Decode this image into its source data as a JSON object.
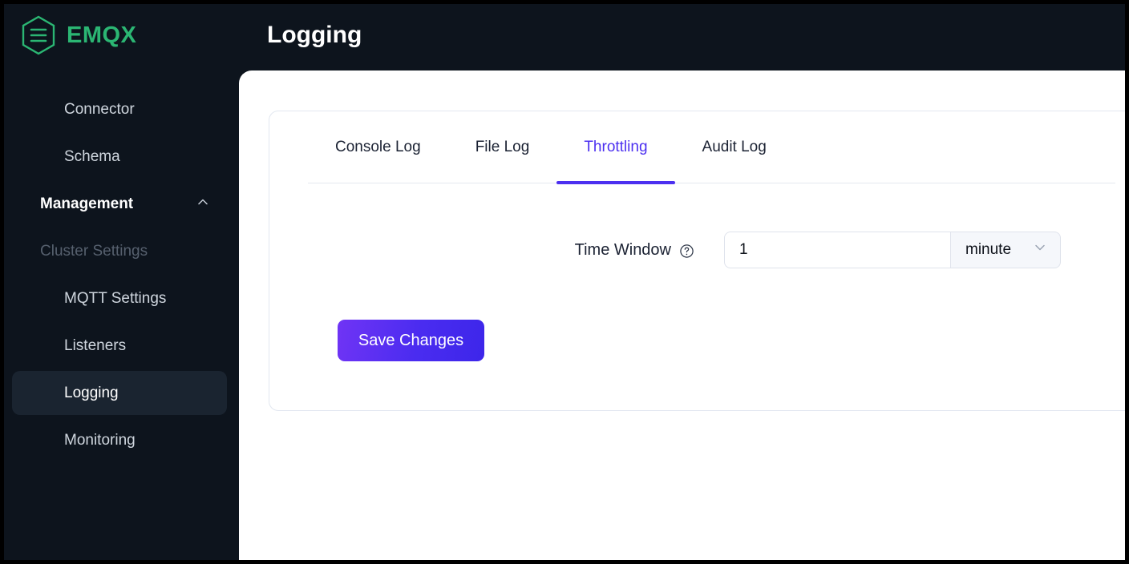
{
  "brand": {
    "name": "EMQX",
    "logo_icon": "emqx-hexagon-logo",
    "color": "#2bb673"
  },
  "sidebar": {
    "items": [
      {
        "label": "Connector",
        "type": "link",
        "active": false
      },
      {
        "label": "Schema",
        "type": "link",
        "active": false
      },
      {
        "label": "Management",
        "type": "group",
        "active": false,
        "chevron": "chevron-up-icon"
      },
      {
        "label": "Cluster Settings",
        "type": "section",
        "active": false
      },
      {
        "label": "MQTT Settings",
        "type": "link",
        "active": false
      },
      {
        "label": "Listeners",
        "type": "link",
        "active": false
      },
      {
        "label": "Logging",
        "type": "link",
        "active": true
      },
      {
        "label": "Monitoring",
        "type": "link",
        "active": false
      }
    ]
  },
  "header": {
    "title": "Logging"
  },
  "main": {
    "tabs": [
      {
        "label": "Console Log",
        "active": false
      },
      {
        "label": "File Log",
        "active": false
      },
      {
        "label": "Throttling",
        "active": true
      },
      {
        "label": "Audit Log",
        "active": false
      }
    ],
    "active_tab_color": "#4c30f0",
    "form": {
      "time_window": {
        "label": "Time Window",
        "help_icon": "question-circle-icon",
        "value": "1",
        "placeholder": "",
        "unit": "minute",
        "unit_chevron": "chevron-down-icon"
      }
    },
    "save_label": "Save Changes"
  }
}
